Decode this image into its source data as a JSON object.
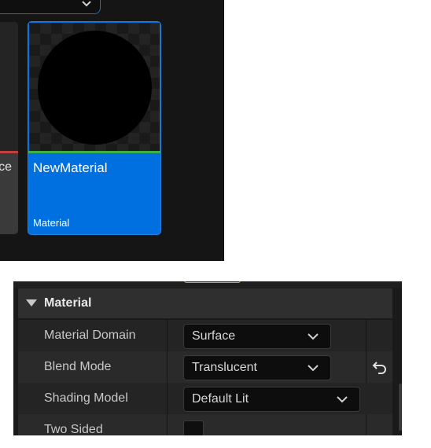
{
  "content_browser": {
    "left_tile": {
      "name_fragment": "ce"
    },
    "selected_tile": {
      "name": "NewMaterial",
      "type": "Material"
    }
  },
  "details": {
    "category": "Material",
    "rows": [
      {
        "label": "Material Domain",
        "value": "Surface"
      },
      {
        "label": "Blend Mode",
        "value": "Translucent"
      },
      {
        "label": "Shading Model",
        "value": "Default Lit"
      },
      {
        "label": "Two Sided"
      }
    ]
  },
  "icons": {
    "filter_dropdown": "chevron-down-icon",
    "category_toggle": "triangle-down-icon",
    "reset": "reset-to-default-icon"
  }
}
